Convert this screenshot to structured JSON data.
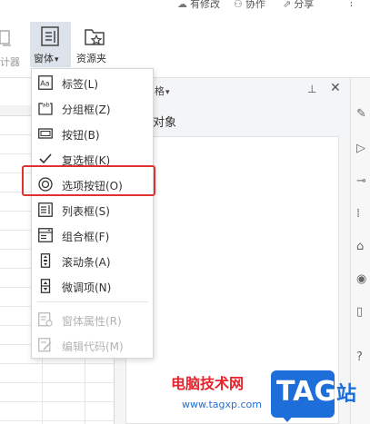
{
  "topbar": {
    "changes": "有修改",
    "collab": "协作",
    "share": "分享",
    "more": "⋮"
  },
  "ribbon": {
    "partial_label": "计器",
    "form_label": "窗体",
    "form_arrow": "▾",
    "resource_label": "资源夹"
  },
  "panel": {
    "header_suffix": "格",
    "header_arrow": "▾",
    "objects_title": "中的对象",
    "pin": "⊥",
    "close": "✕"
  },
  "menu": {
    "items": [
      {
        "label": "标签(L)",
        "icon": "label-icon",
        "enabled": true
      },
      {
        "label": "分组框(Z)",
        "icon": "groupbox-icon",
        "enabled": true
      },
      {
        "label": "按钮(B)",
        "icon": "button-icon",
        "enabled": true
      },
      {
        "label": "复选框(K)",
        "icon": "checkbox-icon",
        "enabled": true
      },
      {
        "label": "选项按钮(O)",
        "icon": "radio-icon",
        "enabled": true
      },
      {
        "label": "列表框(S)",
        "icon": "listbox-icon",
        "enabled": true
      },
      {
        "label": "组合框(F)",
        "icon": "combobox-icon",
        "enabled": true
      },
      {
        "label": "滚动条(A)",
        "icon": "scrollbar-icon",
        "enabled": true
      },
      {
        "label": "微调项(N)",
        "icon": "spinner-icon",
        "enabled": true
      },
      {
        "label": "窗体属性(R)",
        "icon": "form-properties-icon",
        "enabled": false
      },
      {
        "label": "编辑代码(M)",
        "icon": "edit-code-icon",
        "enabled": false
      }
    ],
    "icon_texts": {
      "label": "Aa",
      "groupbox": "ab"
    }
  },
  "watermark": {
    "title": "电脑技术网",
    "url": "www.tagxp.com",
    "tag": "TAG",
    "suffix": "站"
  },
  "colors": {
    "highlight": "#e0312f",
    "watermark_red": "#e8232a",
    "watermark_blue": "#1d6ed8"
  }
}
